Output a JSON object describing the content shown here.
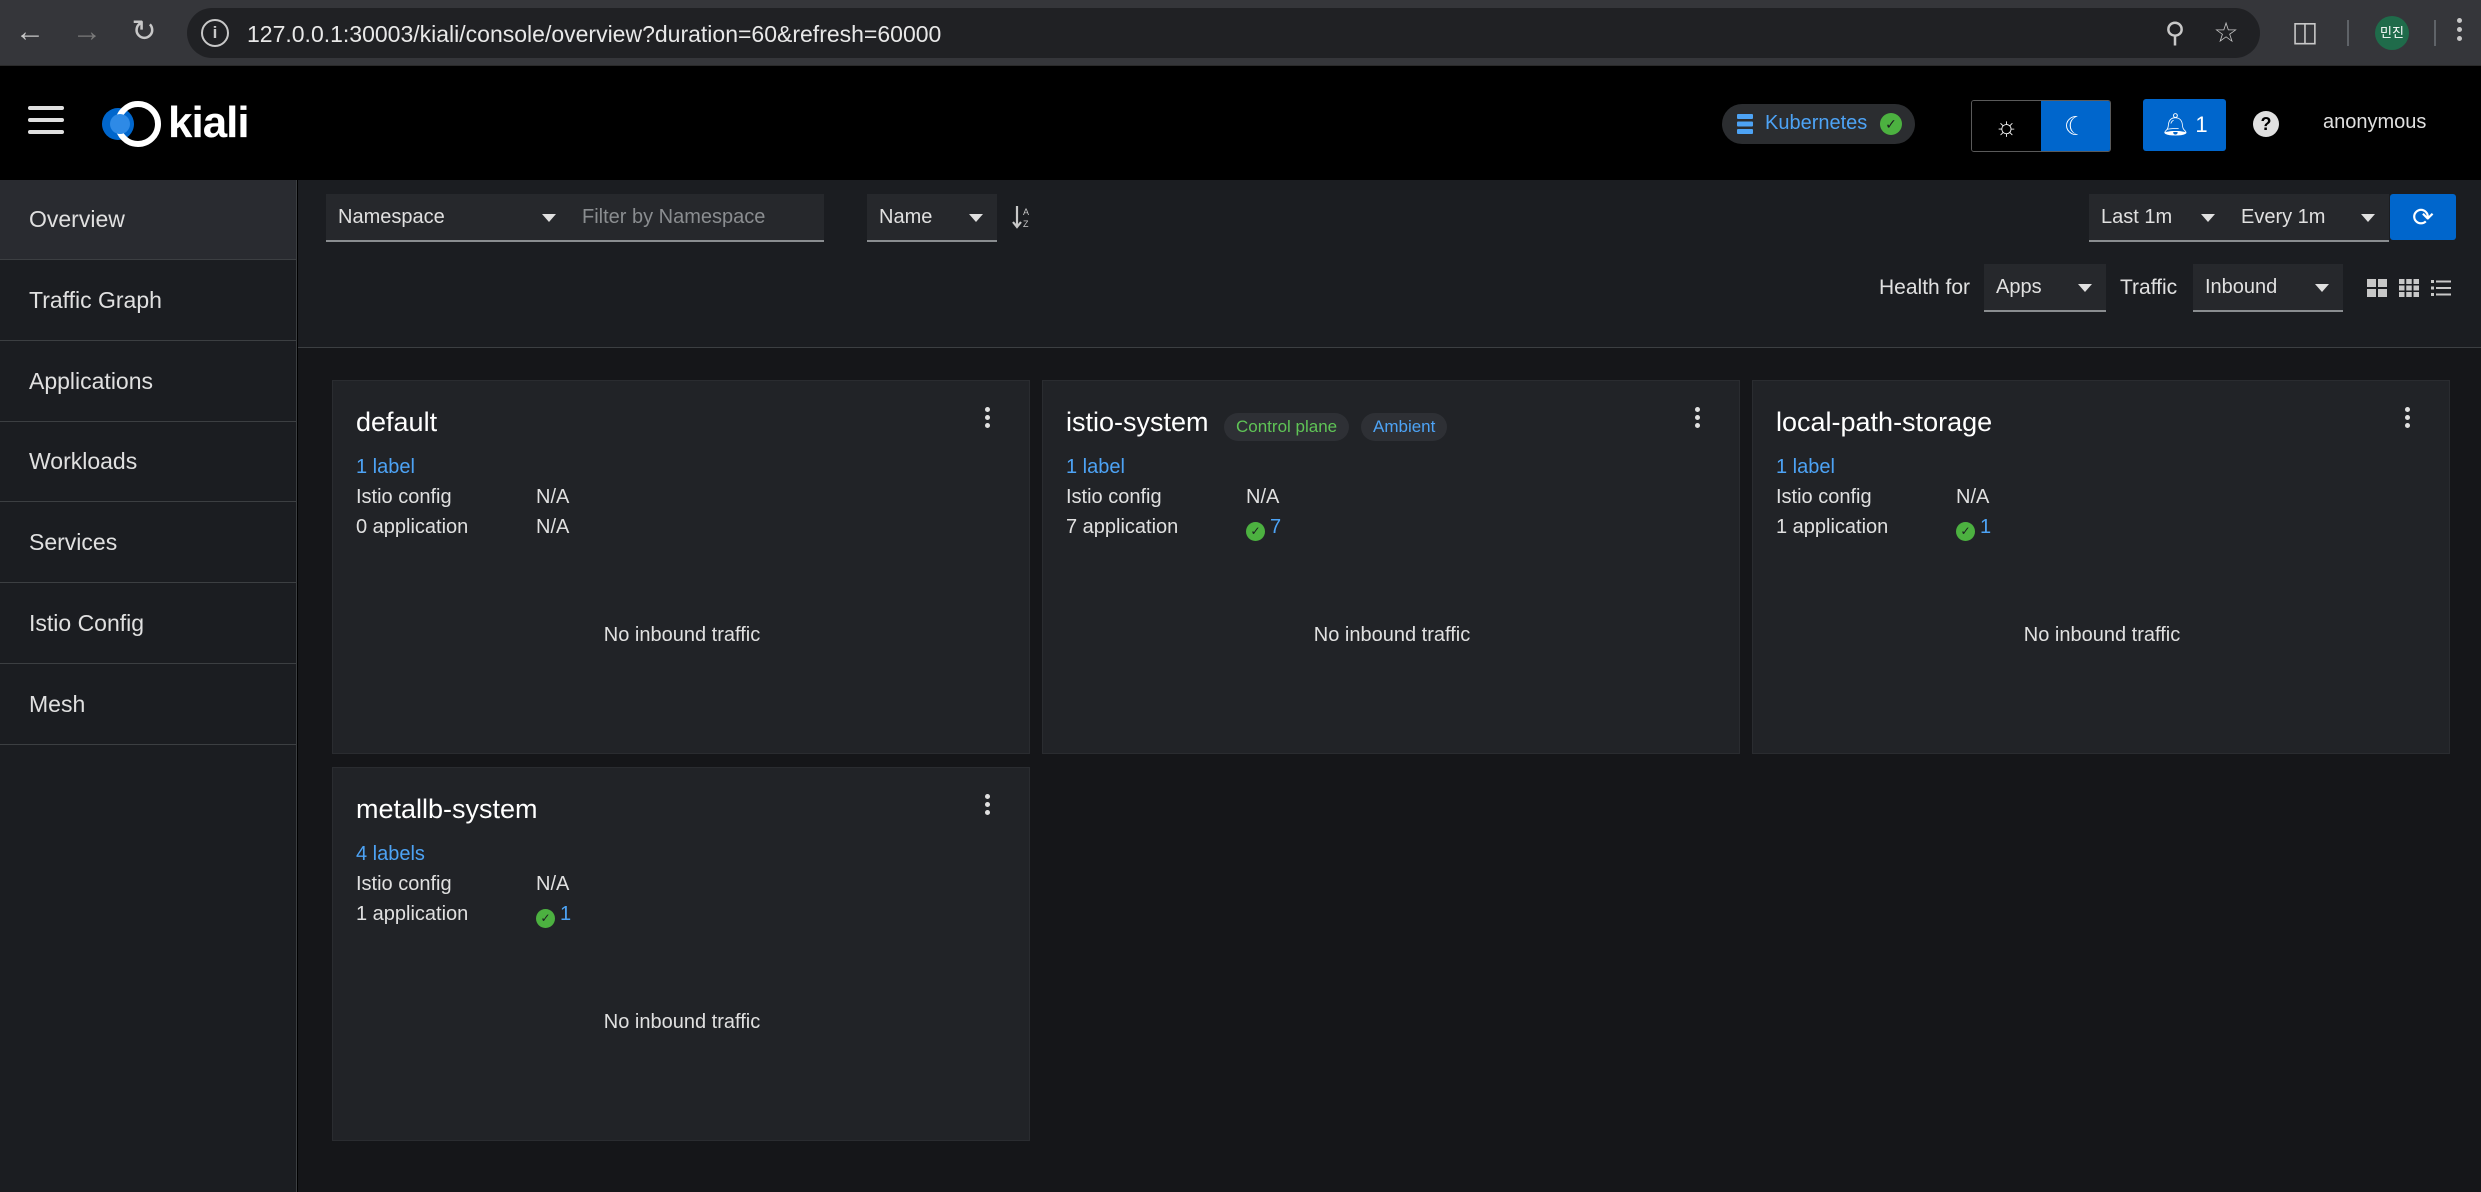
{
  "browser": {
    "url": "127.0.0.1:30003/kiali/console/overview?duration=60&refresh=60000",
    "profile_initials": "민진"
  },
  "masthead": {
    "logo_text": "kiali",
    "cluster": "Kubernetes",
    "notification_count": "1",
    "user": "anonymous"
  },
  "sidebar": {
    "items": [
      {
        "label": "Overview",
        "active": true
      },
      {
        "label": "Traffic Graph"
      },
      {
        "label": "Applications"
      },
      {
        "label": "Workloads"
      },
      {
        "label": "Services"
      },
      {
        "label": "Istio Config"
      },
      {
        "label": "Mesh"
      }
    ]
  },
  "toolbar": {
    "filter_type": "Namespace",
    "filter_placeholder": "Filter by Namespace",
    "sort_field": "Name",
    "duration": "Last 1m",
    "refresh_interval": "Every 1m",
    "health_for_label": "Health for",
    "health_for_value": "Apps",
    "traffic_label": "Traffic",
    "traffic_value": "Inbound"
  },
  "cards": [
    {
      "name": "default",
      "tags": [],
      "labels": "1 label",
      "istio_config_label": "Istio config",
      "istio_config_value": "N/A",
      "apps_label": "0 application",
      "apps_value": "N/A",
      "apps_healthy": false,
      "traffic": "No inbound traffic"
    },
    {
      "name": "istio-system",
      "tags": [
        "Control plane",
        "Ambient"
      ],
      "labels": "1 label",
      "istio_config_label": "Istio config",
      "istio_config_value": "N/A",
      "apps_label": "7 application",
      "apps_value": "7",
      "apps_healthy": true,
      "traffic": "No inbound traffic"
    },
    {
      "name": "local-path-storage",
      "tags": [],
      "labels": "1 label",
      "istio_config_label": "Istio config",
      "istio_config_value": "N/A",
      "apps_label": "1 application",
      "apps_value": "1",
      "apps_healthy": true,
      "traffic": "No inbound traffic"
    },
    {
      "name": "metallb-system",
      "tags": [],
      "labels": "4 labels",
      "istio_config_label": "Istio config",
      "istio_config_value": "N/A",
      "apps_label": "1 application",
      "apps_value": "1",
      "apps_healthy": true,
      "traffic": "No inbound traffic"
    }
  ],
  "colors": {
    "accent": "#0066cc",
    "link": "#4da3f5",
    "healthy": "#4cb140"
  }
}
